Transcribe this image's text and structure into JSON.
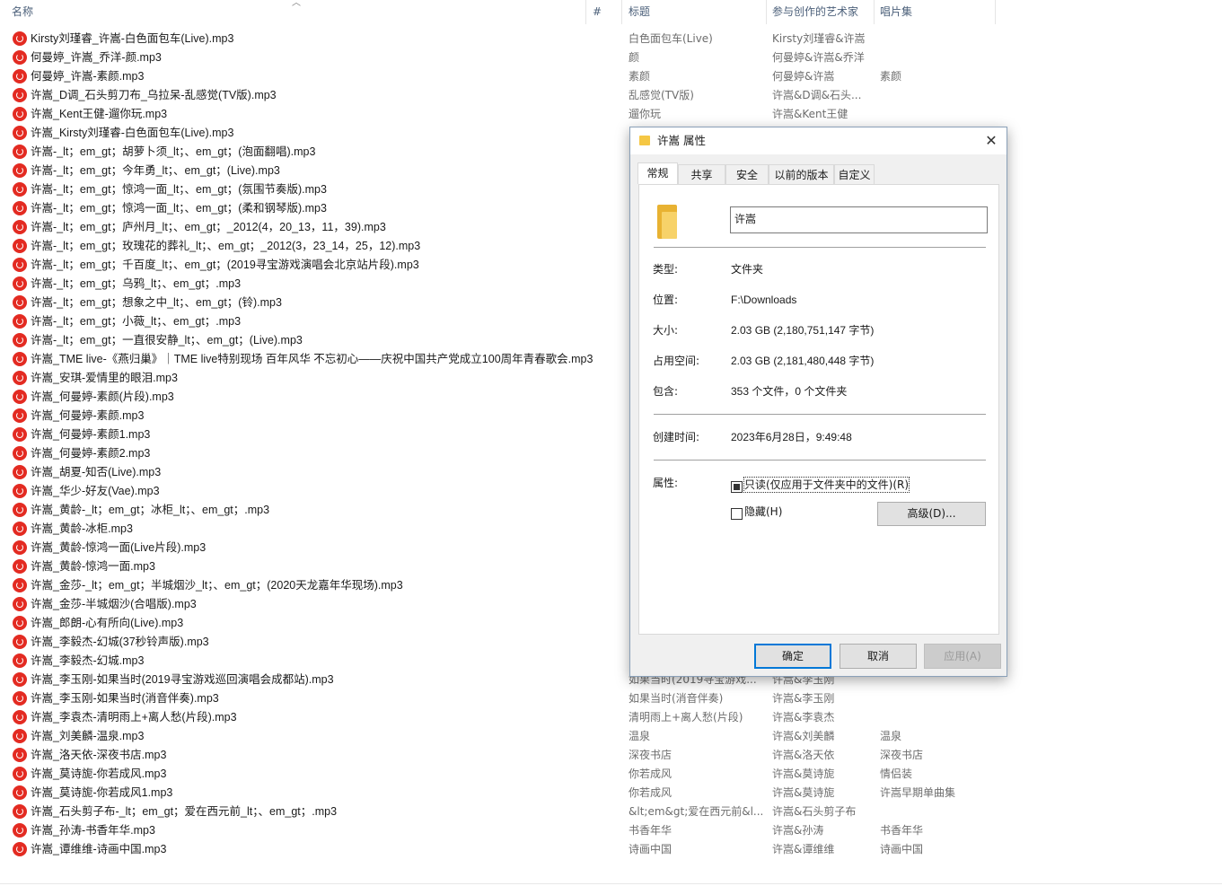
{
  "columns": {
    "name": "名称",
    "number": "#",
    "title": "标题",
    "artist": "参与创作的艺术家",
    "album": "唱片集"
  },
  "files": [
    {
      "name": "Kirsty刘瑾睿_许嵩-白色面包车(Live).mp3",
      "title": "白色面包车(Live)",
      "artist": "Kirsty刘瑾睿&许嵩",
      "album": ""
    },
    {
      "name": "何曼婷_许嵩_乔洋-颜.mp3",
      "title": "颜",
      "artist": "何曼婷&许嵩&乔洋",
      "album": ""
    },
    {
      "name": "何曼婷_许嵩-素颜.mp3",
      "title": "素颜",
      "artist": "何曼婷&许嵩",
      "album": "素颜"
    },
    {
      "name": "许嵩_D调_石头剪刀布_乌拉呆-乱感觉(TV版).mp3",
      "title": "乱感觉(TV版)",
      "artist": "许嵩&D调&石头...",
      "album": ""
    },
    {
      "name": "许嵩_Kent王健-遛你玩.mp3",
      "title": "遛你玩",
      "artist": "许嵩&Kent王健",
      "album": ""
    },
    {
      "name": "许嵩_Kirsty刘瑾睿-白色面包车(Live).mp3",
      "title": "",
      "artist": "",
      "album": ""
    },
    {
      "name": "许嵩-_lt；em_gt；胡萝卜须_lt；、em_gt；(泡面翻唱).mp3",
      "title": "",
      "artist": "",
      "album": ""
    },
    {
      "name": "许嵩-_lt；em_gt；今年勇_lt；、em_gt；(Live).mp3",
      "title": "",
      "artist": "",
      "album": ""
    },
    {
      "name": "许嵩-_lt；em_gt；惊鸿一面_lt；、em_gt；(氛围节奏版).mp3",
      "title": "",
      "artist": "",
      "album": ""
    },
    {
      "name": "许嵩-_lt；em_gt；惊鸿一面_lt；、em_gt；(柔和钢琴版).mp3",
      "title": "",
      "artist": "",
      "album": ""
    },
    {
      "name": "许嵩-_lt；em_gt；庐州月_lt；、em_gt；_2012(4，20_13，11，39).mp3",
      "title": "",
      "artist": "",
      "album": ""
    },
    {
      "name": "许嵩-_lt；em_gt；玫瑰花的葬礼_lt；、em_gt；_2012(3，23_14，25，12).mp3",
      "title": "",
      "artist": "",
      "album": ""
    },
    {
      "name": "许嵩-_lt；em_gt；千百度_lt；、em_gt；(2019寻宝游戏演唱会北京站片段).mp3",
      "title": "",
      "artist": "",
      "album": ""
    },
    {
      "name": "许嵩-_lt；em_gt；乌鸦_lt；、em_gt；.mp3",
      "title": "",
      "artist": "",
      "album": ""
    },
    {
      "name": "许嵩-_lt；em_gt；想象之中_lt；、em_gt；(铃).mp3",
      "title": "",
      "artist": "",
      "album": ""
    },
    {
      "name": "许嵩-_lt；em_gt；小薇_lt；、em_gt；.mp3",
      "title": "",
      "artist": "",
      "album": ""
    },
    {
      "name": "许嵩-_lt；em_gt；一直很安静_lt；、em_gt；(Live).mp3",
      "title": "",
      "artist": "",
      "album": ""
    },
    {
      "name": "许嵩_TME live-《燕归巢》｜TME live特别现场 百年风华 不忘初心——庆祝中国共产党成立100周年青春歌会.mp3",
      "title": "",
      "artist": "",
      "album": ""
    },
    {
      "name": "许嵩_安琪-爱情里的眼泪.mp3",
      "title": "",
      "artist": "",
      "album": ""
    },
    {
      "name": "许嵩_何曼婷-素颜(片段).mp3",
      "title": "",
      "artist": "",
      "album": ""
    },
    {
      "name": "许嵩_何曼婷-素颜.mp3",
      "title": "",
      "artist": "",
      "album": ""
    },
    {
      "name": "许嵩_何曼婷-素颜1.mp3",
      "title": "",
      "artist": "",
      "album": ""
    },
    {
      "name": "许嵩_何曼婷-素颜2.mp3",
      "title": "",
      "artist": "",
      "album": ""
    },
    {
      "name": "许嵩_胡夏-知否(Live).mp3",
      "title": "",
      "artist": "",
      "album": ""
    },
    {
      "name": "许嵩_华少-好友(Vae).mp3",
      "title": "",
      "artist": "",
      "album": ""
    },
    {
      "name": "许嵩_黄龄-_lt；em_gt；冰柜_lt；、em_gt；.mp3",
      "title": "",
      "artist": "",
      "album": ""
    },
    {
      "name": "许嵩_黄龄-冰柜.mp3",
      "title": "",
      "artist": "",
      "album": ""
    },
    {
      "name": "许嵩_黄龄-惊鸿一面(Live片段).mp3",
      "title": "",
      "artist": "",
      "album": ""
    },
    {
      "name": "许嵩_黄龄-惊鸿一面.mp3",
      "title": "",
      "artist": "",
      "album": ""
    },
    {
      "name": "许嵩_金莎-_lt；em_gt；半城烟沙_lt；、em_gt；(2020天龙嘉年华现场).mp3",
      "title": "",
      "artist": "",
      "album": ""
    },
    {
      "name": "许嵩_金莎-半城烟沙(合唱版).mp3",
      "title": "",
      "artist": "",
      "album": ""
    },
    {
      "name": "许嵩_郎朗-心有所向(Live).mp3",
      "title": "",
      "artist": "",
      "album": ""
    },
    {
      "name": "许嵩_李毅杰-幻城(37秒铃声版).mp3",
      "title": "",
      "artist": "",
      "album": ""
    },
    {
      "name": "许嵩_李毅杰-幻城.mp3",
      "title": "",
      "artist": "",
      "album": ""
    },
    {
      "name": "许嵩_李玉刚-如果当时(2019寻宝游戏巡回演唱会成都站).mp3",
      "title": "如果当时(2019寻宝游戏...",
      "artist": "许嵩&李玉刚",
      "album": ""
    },
    {
      "name": "许嵩_李玉刚-如果当时(消音伴奏).mp3",
      "title": "如果当时(消音伴奏)",
      "artist": "许嵩&李玉刚",
      "album": ""
    },
    {
      "name": "许嵩_李袁杰-清明雨上+离人愁(片段).mp3",
      "title": "清明雨上+离人愁(片段)",
      "artist": "许嵩&李袁杰",
      "album": ""
    },
    {
      "name": "许嵩_刘美麟-温泉.mp3",
      "title": "温泉",
      "artist": "许嵩&刘美麟",
      "album": "温泉"
    },
    {
      "name": "许嵩_洛天依-深夜书店.mp3",
      "title": "深夜书店",
      "artist": "许嵩&洛天依",
      "album": "深夜书店"
    },
    {
      "name": "许嵩_莫诗旎-你若成风.mp3",
      "title": "你若成风",
      "artist": "许嵩&莫诗旎",
      "album": "情侣装"
    },
    {
      "name": "许嵩_莫诗旎-你若成风1.mp3",
      "title": "你若成风",
      "artist": "许嵩&莫诗旎",
      "album": "许嵩早期单曲集"
    },
    {
      "name": "许嵩_石头剪子布-_lt；em_gt；爱在西元前_lt；、em_gt；.mp3",
      "title": "&lt;em&gt;爱在西元前&l...",
      "artist": "许嵩&石头剪子布",
      "album": ""
    },
    {
      "name": "许嵩_孙涛-书香年华.mp3",
      "title": "书香年华",
      "artist": "许嵩&孙涛",
      "album": "书香年华"
    },
    {
      "name": "许嵩_谭维维-诗画中国.mp3",
      "title": "诗画中国",
      "artist": "许嵩&谭维维",
      "album": "诗画中国"
    }
  ],
  "dialog": {
    "title": "许嵩 属性",
    "close": "✕",
    "tabs": [
      "常规",
      "共享",
      "安全",
      "以前的版本",
      "自定义"
    ],
    "folder_name": "许嵩",
    "props": {
      "type_label": "类型:",
      "type_value": "文件夹",
      "location_label": "位置:",
      "location_value": "F:\\Downloads",
      "size_label": "大小:",
      "size_value": "2.03 GB (2,180,751,147 字节)",
      "disk_label": "占用空间:",
      "disk_value": "2.03 GB (2,181,480,448 字节)",
      "contains_label": "包含:",
      "contains_value": "353 个文件，0 个文件夹",
      "created_label": "创建时间:",
      "created_value": "2023年6月28日，9:49:48",
      "attrs_label": "属性:",
      "readonly_label": "只读(仅应用于文件夹中的文件)(R)",
      "hidden_label": "隐藏(H)",
      "advanced_label": "高级(D)..."
    },
    "buttons": {
      "ok": "确定",
      "cancel": "取消",
      "apply": "应用(A)"
    }
  },
  "colors": {
    "accent": "#0078d7",
    "header_text": "#4c607a",
    "music_icon": "#e32b22"
  }
}
